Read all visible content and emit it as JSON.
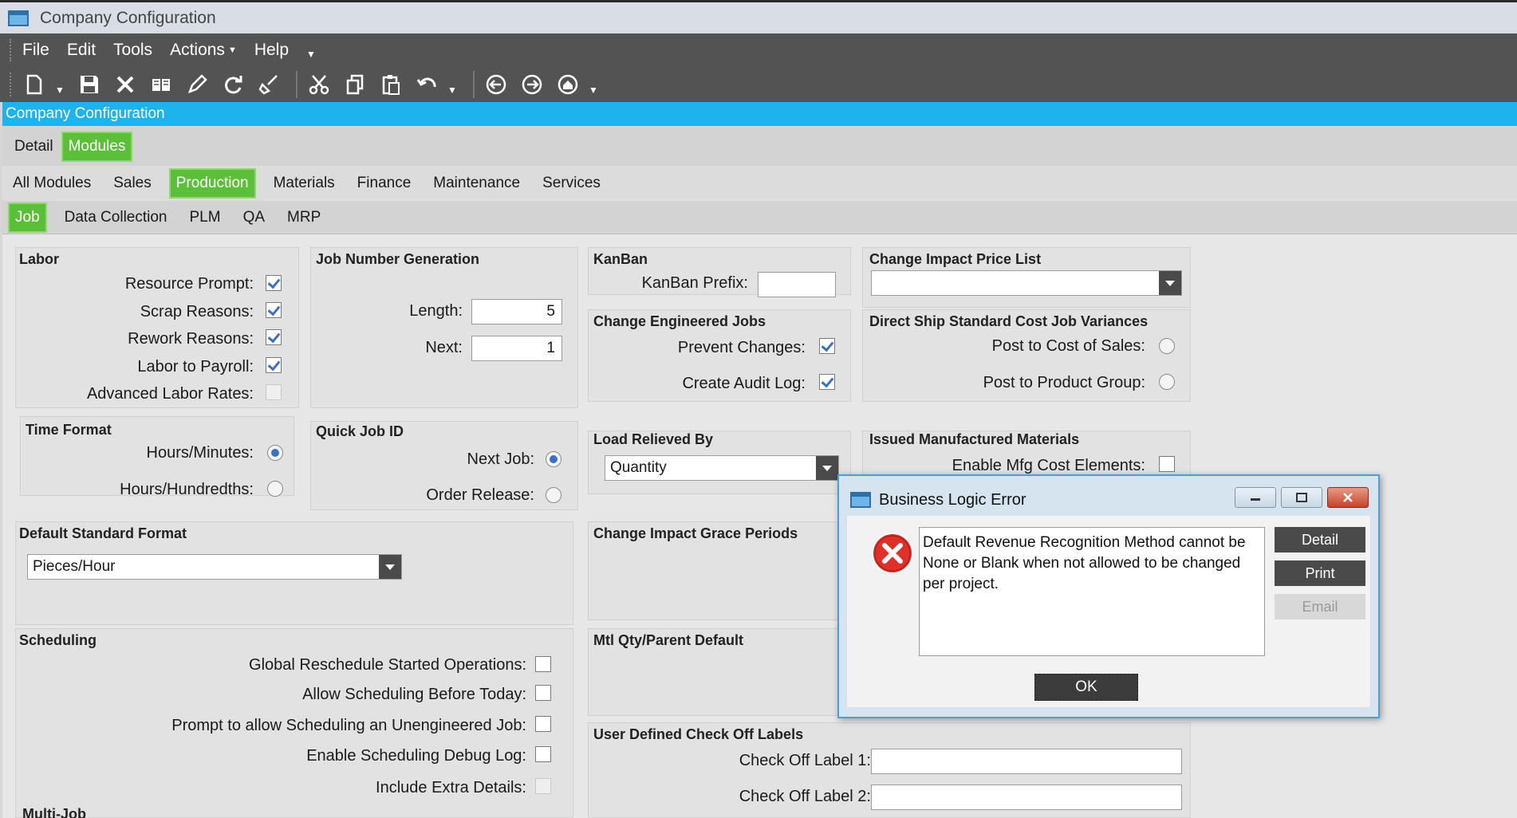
{
  "window": {
    "title": "Company Configuration"
  },
  "menu": {
    "file": "File",
    "edit": "Edit",
    "tools": "Tools",
    "actions": "Actions",
    "help": "Help"
  },
  "toolbar": {
    "icons": [
      "new-icon",
      "save-icon",
      "delete-icon",
      "open-book-icon",
      "pencil-icon",
      "refresh-icon",
      "broom-icon",
      "cut-icon",
      "copy-icon",
      "paste-icon",
      "undo-icon",
      "back-icon",
      "forward-icon",
      "home-icon"
    ]
  },
  "header": {
    "title": "Company Configuration"
  },
  "tabs": {
    "top": [
      {
        "label": "Detail",
        "active": false
      },
      {
        "label": "Modules",
        "active": true
      }
    ],
    "modules": [
      {
        "label": "All Modules",
        "active": false
      },
      {
        "label": "Sales",
        "active": false
      },
      {
        "label": "Production",
        "active": true
      },
      {
        "label": "Materials",
        "active": false
      },
      {
        "label": "Finance",
        "active": false
      },
      {
        "label": "Maintenance",
        "active": false
      },
      {
        "label": "Services",
        "active": false
      }
    ],
    "production": [
      {
        "label": "Job",
        "active": true
      },
      {
        "label": "Data Collection",
        "active": false
      },
      {
        "label": "PLM",
        "active": false
      },
      {
        "label": "QA",
        "active": false
      },
      {
        "label": "MRP",
        "active": false
      }
    ]
  },
  "labor": {
    "title": "Labor",
    "resource_prompt": "Resource Prompt:",
    "scrap_reasons": "Scrap Reasons:",
    "rework_reasons": "Rework Reasons:",
    "labor_to_payroll": "Labor to Payroll:",
    "advanced_labor_rates": "Advanced Labor Rates:"
  },
  "time_format": {
    "title": "Time Format",
    "hours_minutes": "Hours/Minutes:",
    "hours_hundredths": "Hours/Hundredths:"
  },
  "default_standard_format": {
    "title": "Default Standard Format",
    "value": "Pieces/Hour"
  },
  "scheduling": {
    "title": "Scheduling",
    "global_reschedule": "Global Reschedule Started Operations:",
    "allow_before_today": "Allow Scheduling Before Today:",
    "prompt_unengineered": "Prompt to allow Scheduling an Unengineered Job:",
    "debug_log": "Enable Scheduling Debug Log:",
    "include_extra": "Include Extra Details:",
    "multi_job": "Multi-Job"
  },
  "job_number": {
    "title": "Job Number Generation",
    "length_label": "Length:",
    "length_value": "5",
    "next_label": "Next:",
    "next_value": "1"
  },
  "quick_job": {
    "title": "Quick Job ID",
    "next_job": "Next Job:",
    "order_release": "Order Release:"
  },
  "kanban": {
    "title": "KanBan",
    "prefix_label": "KanBan Prefix:",
    "prefix_value": ""
  },
  "change_engineered": {
    "title": "Change Engineered Jobs",
    "prevent_changes": "Prevent Changes:",
    "audit_log": "Create Audit Log:"
  },
  "load_relieved": {
    "title": "Load Relieved By",
    "value": "Quantity"
  },
  "grace_periods": {
    "title": "Change Impact Grace Periods"
  },
  "mtl_qty": {
    "title": "Mtl Qty/Parent Default"
  },
  "check_off": {
    "title": "User Defined Check Off Labels",
    "label1": "Check Off Label 1:",
    "label2": "Check Off Label 2:",
    "value1": "",
    "value2": ""
  },
  "price_list": {
    "title": "Change Impact Price List",
    "value": ""
  },
  "direct_ship": {
    "title": "Direct Ship Standard Cost Job Variances",
    "cost_of_sales": "Post to Cost of Sales:",
    "product_group": "Post to Product Group:"
  },
  "issued_mfg": {
    "title": "Issued Manufactured Materials",
    "enable_cost": "Enable Mfg Cost Elements:"
  },
  "dialog": {
    "title": "Business Logic Error",
    "message": "Default Revenue Recognition Method cannot be None or Blank when not allowed to be changed per project.",
    "detail": "Detail",
    "print": "Print",
    "email": "Email",
    "ok": "OK"
  },
  "colors": {
    "accent": "#1fb3ee",
    "active_tab": "#5cbf3a",
    "toolbar": "#535353",
    "error": "#e0302a"
  }
}
